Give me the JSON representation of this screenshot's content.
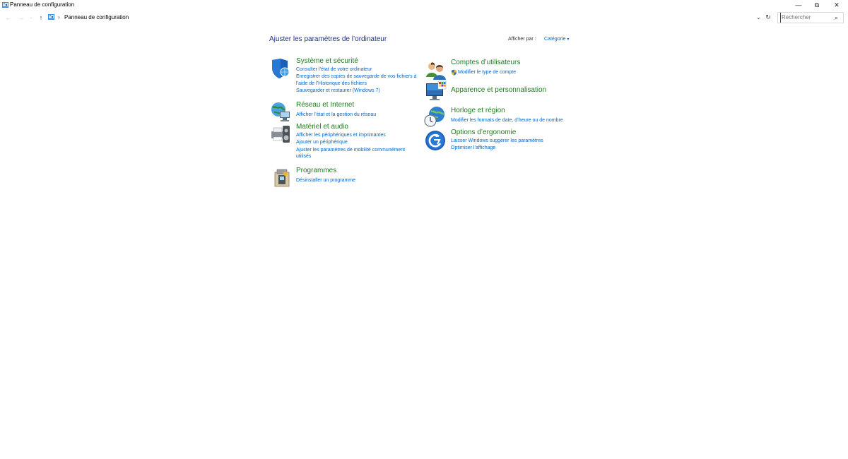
{
  "window": {
    "title": "Panneau de configuration",
    "controls": {
      "minimize": "—",
      "restore": "⧉",
      "close": "✕"
    }
  },
  "navigation": {
    "back": "←",
    "forward": "→",
    "recent": "⌄",
    "up": "↑",
    "separator": "›",
    "address": "Panneau de configuration",
    "address_dropdown": "⌄",
    "refresh": "↻",
    "search_placeholder": "Rechercher",
    "search_glyph": "⌕"
  },
  "main": {
    "title": "Ajuster les paramètres de l’ordinateur",
    "view_by_label": "Afficher par :",
    "view_by_value": "Catégorie",
    "view_by_caret": "▾"
  },
  "categories": {
    "system_security": {
      "title": "Système et sécurité",
      "icon": "shield-icon",
      "links": [
        "Consulter l’état de votre ordinateur",
        "Enregistrer des copies de sauvegarde de vos fichiers à",
        "l’aide de l’Historique des fichiers",
        "Sauvegarder et restaurer (Windows 7)"
      ]
    },
    "network": {
      "title": "Réseau et Internet",
      "icon": "network-globe-icon",
      "links": [
        "Afficher l’état et la gestion du réseau"
      ]
    },
    "hardware": {
      "title": "Matériel et audio",
      "icon": "printer-speaker-icon",
      "links": [
        "Afficher les périphériques et imprimantes",
        "Ajouter un périphérique",
        "Ajuster les paramètres de mobilité communément",
        "utilisés"
      ]
    },
    "programs": {
      "title": "Programmes",
      "icon": "programs-box-icon",
      "links": [
        "Désinstaller un programme"
      ]
    },
    "accounts": {
      "title": "Comptes d’utilisateurs",
      "icon": "users-icon",
      "links": [
        "Modifier le type de compte"
      ],
      "link_icon": "uac-shield-icon"
    },
    "appearance": {
      "title": "Apparence et personnalisation",
      "icon": "monitor-palette-icon",
      "links": []
    },
    "clock": {
      "title": "Horloge et région",
      "icon": "clock-globe-icon",
      "links": [
        "Modifier les formats de date, d’heure ou de nombre"
      ]
    },
    "ease": {
      "title": "Options d’ergonomie",
      "icon": "ease-of-access-icon",
      "links": [
        "Laisser Windows suggérer les paramètres",
        "Optimiser l’affichage"
      ]
    }
  },
  "colors": {
    "category_title": "#1e7b21",
    "link": "#0066cc",
    "page_title": "#1e3287"
  }
}
